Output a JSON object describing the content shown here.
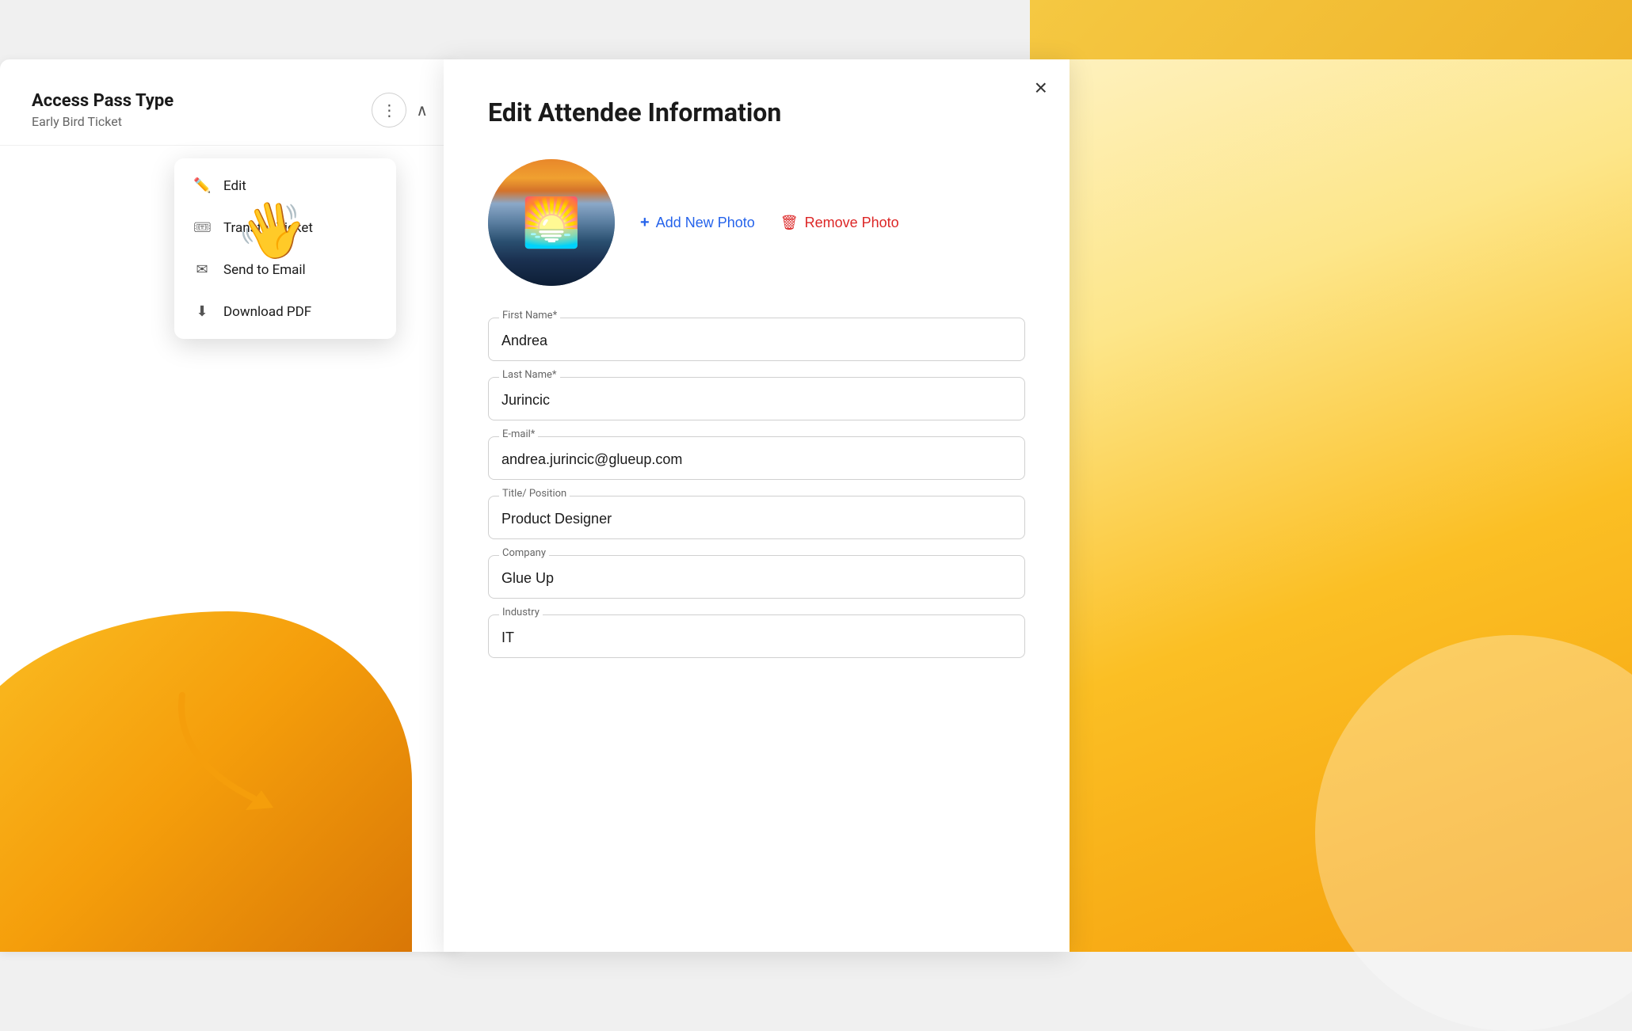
{
  "background": {
    "color": "#f5f5f5"
  },
  "left_panel": {
    "access_pass_type_label": "Access Pass Type",
    "ticket_name": "Early Bird Ticket"
  },
  "dropdown": {
    "items": [
      {
        "id": "edit",
        "label": "Edit",
        "icon": "pencil"
      },
      {
        "id": "transfer",
        "label": "Transfer Ticket",
        "icon": "ticket"
      },
      {
        "id": "send-email",
        "label": "Send to Email",
        "icon": "email"
      },
      {
        "id": "download-pdf",
        "label": "Download PDF",
        "icon": "download"
      }
    ]
  },
  "modal": {
    "title": "Edit Attendee Information",
    "close_label": "×",
    "photo_actions": {
      "add_label": "Add New Photo",
      "remove_label": "Remove Photo"
    },
    "fields": [
      {
        "id": "first-name",
        "label": "First Name*",
        "value": "Andrea"
      },
      {
        "id": "last-name",
        "label": "Last Name*",
        "value": "Jurincic"
      },
      {
        "id": "email",
        "label": "E-mail*",
        "value": "andrea.jurincic@glueup.com"
      },
      {
        "id": "title",
        "label": "Title/ Position",
        "value": "Product Designer"
      },
      {
        "id": "company",
        "label": "Company",
        "value": "Glue Up"
      },
      {
        "id": "industry",
        "label": "Industry",
        "value": "IT"
      }
    ]
  },
  "colors": {
    "accent_blue": "#2563eb",
    "accent_red": "#dc2626",
    "yellow_primary": "#fbbf24",
    "text_dark": "#1a1a1a"
  }
}
